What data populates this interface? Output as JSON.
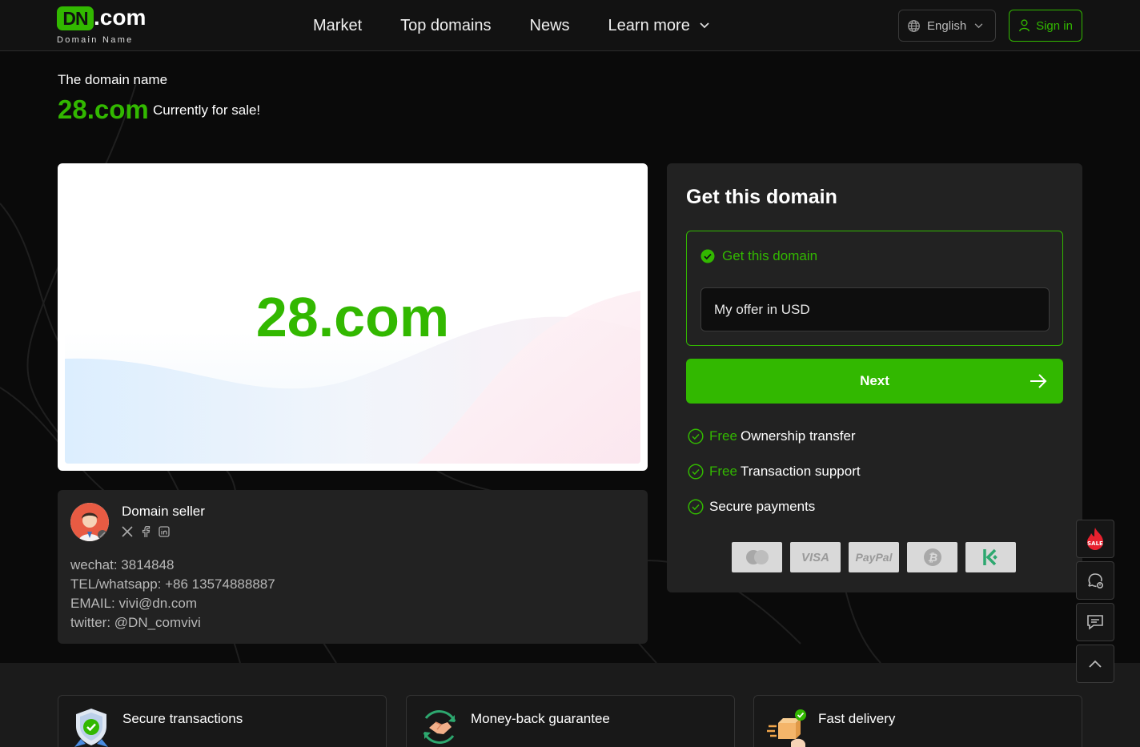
{
  "header": {
    "logo": {
      "badge": "DN",
      "suffix": ".com",
      "tagline": "Domain Name"
    },
    "nav": [
      {
        "label": "Market"
      },
      {
        "label": "Top domains"
      },
      {
        "label": "News"
      },
      {
        "label": "Learn more"
      }
    ],
    "language": "English",
    "sign_in": "Sign in"
  },
  "hero": {
    "label": "The domain name",
    "domain": "28.com",
    "status": "Currently for sale!"
  },
  "preview": {
    "domain": "28.com"
  },
  "seller": {
    "title": "Domain seller",
    "socials": [
      "x-icon",
      "facebook-icon",
      "linkedin-icon"
    ],
    "wechat": "wechat: 3814848",
    "tel": "TEL/whatsapp: +86 13574888887",
    "email": "EMAIL: vivi@dn.com",
    "twitter": "twitter: @DN_comvivi"
  },
  "panel": {
    "title": "Get this domain",
    "option_label": "Get this domain",
    "offer_placeholder": "My offer in USD",
    "next_label": "Next",
    "features": [
      {
        "free": "Free",
        "label": "Ownership transfer"
      },
      {
        "free": "Free",
        "label": "Transaction support"
      },
      {
        "free": "",
        "label": "Secure payments"
      }
    ],
    "payments": [
      "mastercard-icon",
      "VISA",
      "PayPal",
      "bitcoin-icon",
      "kucoin-icon"
    ]
  },
  "benefits": [
    {
      "title": "Secure transactions"
    },
    {
      "title": "Money-back guarantee"
    },
    {
      "title": "Fast delivery"
    }
  ],
  "side_buttons": [
    "sale-icon",
    "chat-question-icon",
    "message-icon",
    "back-to-top-icon"
  ],
  "colors": {
    "accent": "#32b800",
    "background": "#0a0a0a",
    "card": "#222222"
  }
}
